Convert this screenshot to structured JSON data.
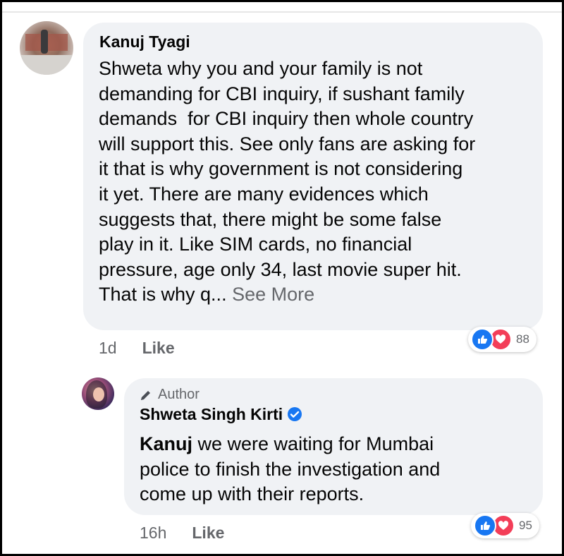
{
  "comment": {
    "author": "Kanuj Tyagi",
    "lines": [
      "Shweta why you and your family is not",
      "demanding for CBI inquiry, if sushant family",
      "demands  for CBI inquiry then whole country",
      "will support this. See only fans are asking for",
      "it that is why government is not considering",
      "it yet. There are many evidences which",
      "suggests that, there might be some false",
      "play in it. Like SIM cards, no financial",
      "pressure, age only 34, last movie super hit.",
      "That is why q..."
    ],
    "see_more": "See More",
    "time": "1d",
    "like_label": "Like",
    "reaction_count": "88"
  },
  "reply": {
    "author_badge": "Author",
    "author": "Shweta Singh Kirti",
    "mention": "Kanuj",
    "line1_rest": " we were waiting for Mumbai",
    "line2": "police to finish the investigation and",
    "line3": "come up with their reports.",
    "time": "16h",
    "like_label": "Like",
    "reaction_count": "95"
  },
  "colors": {
    "bubble": "#f0f2f5",
    "like_blue": "#1877f2",
    "love_red": "#f33e58",
    "secondary_text": "#65676b"
  },
  "icons": [
    "pencil-icon",
    "verified-icon",
    "like-icon",
    "love-icon"
  ]
}
